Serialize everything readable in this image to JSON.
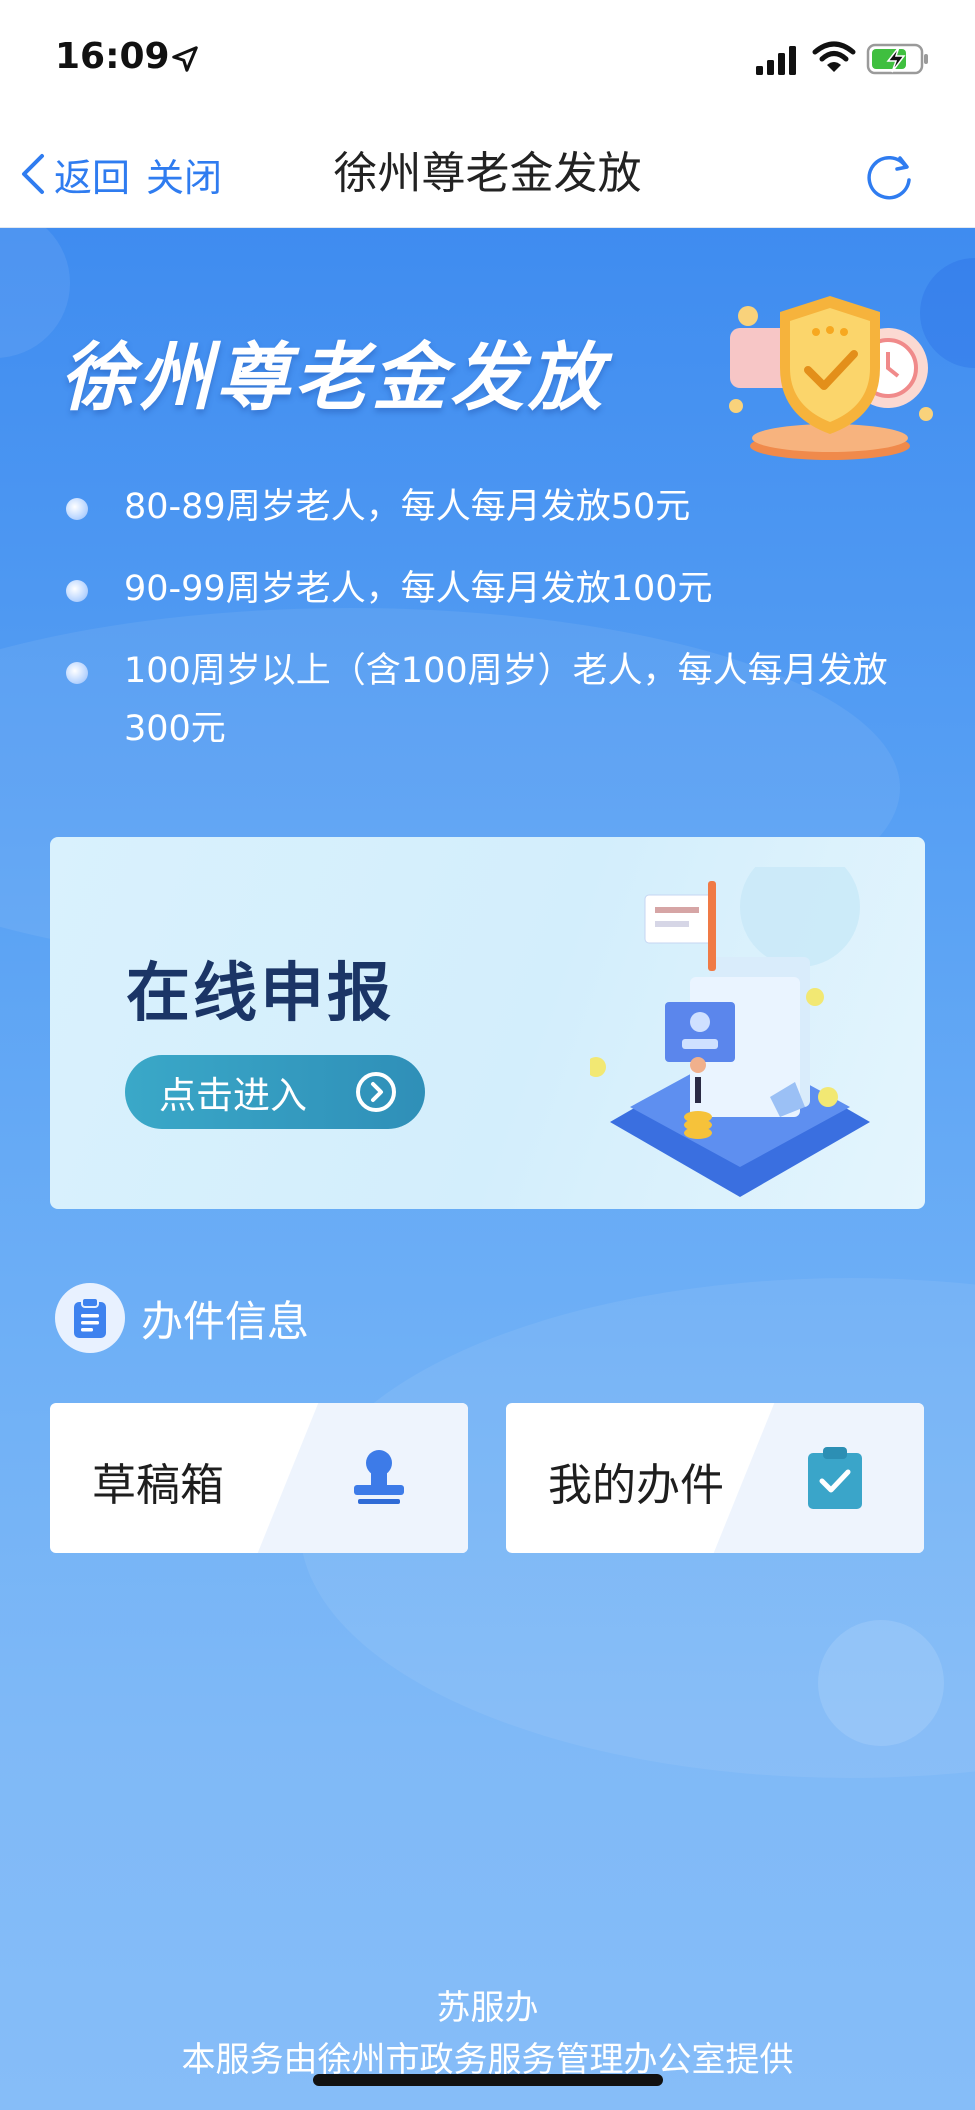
{
  "status_bar": {
    "time": "16:09"
  },
  "nav": {
    "back_label": "返回",
    "close_label": "关闭",
    "title": "徐州尊老金发放"
  },
  "hero": {
    "title": "徐州尊老金发放"
  },
  "rules": [
    "80-89周岁老人，每人每月发放50元",
    "90-99周岁老人，每人每月发放100元",
    "100周岁以上（含100周岁）老人，每人每月发放300元"
  ],
  "apply": {
    "title": "在线申报",
    "button_label": "点击进入"
  },
  "info": {
    "section_title": "办件信息",
    "tiles": [
      {
        "label": "草稿箱",
        "icon": "stamp-icon"
      },
      {
        "label": "我的办件",
        "icon": "clipboard-check-icon"
      }
    ]
  },
  "footer": {
    "brand": "苏服办",
    "provider": "本服务由徐州市政务服务管理办公室提供"
  },
  "colors": {
    "accent": "#2f7cf0",
    "background_top": "#3f8cf0",
    "background_bottom": "#86bdf8",
    "card_title": "#1b3566",
    "button": "#2f8fb8"
  }
}
